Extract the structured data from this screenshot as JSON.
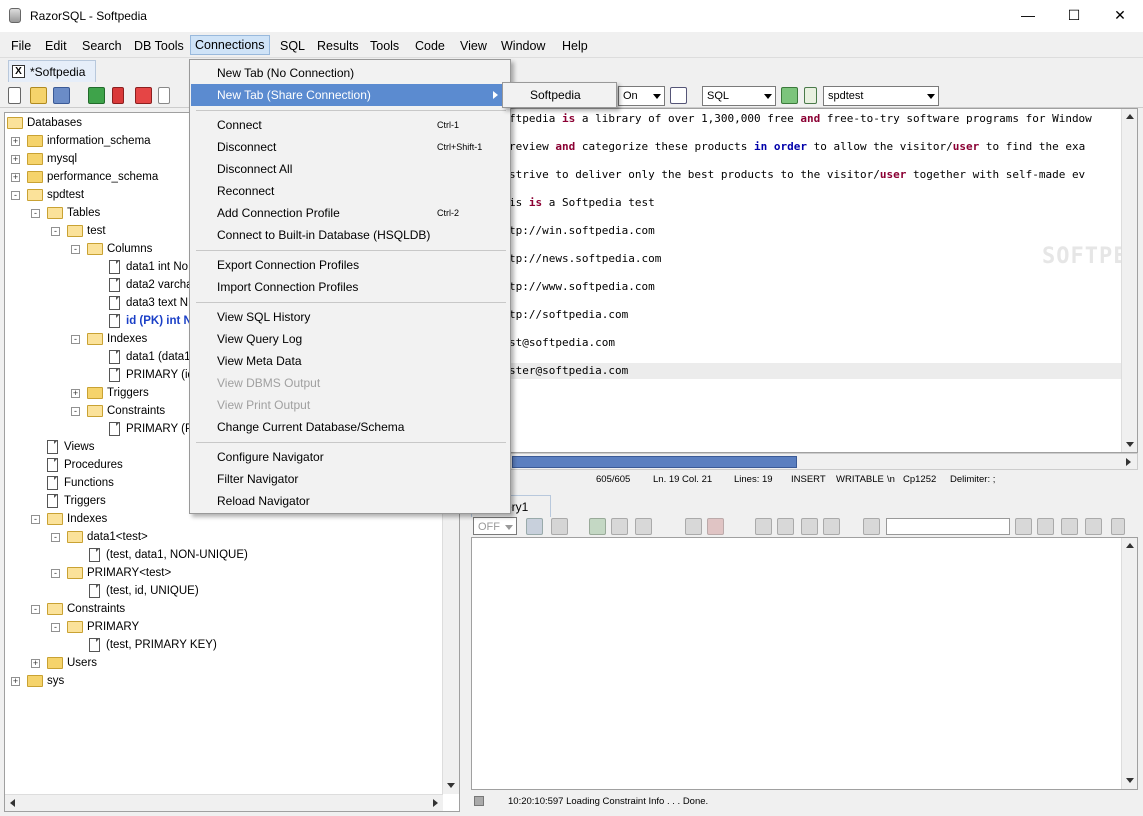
{
  "window": {
    "title": "RazorSQL - Softpedia",
    "minimize": "—",
    "maximize": "☐",
    "close": "✕"
  },
  "menubar": [
    "File",
    "Edit",
    "Search",
    "DB Tools",
    "Connections",
    "SQL",
    "Results",
    "Tools",
    "Code",
    "View",
    "Window",
    "Help"
  ],
  "tab": {
    "label": "*Softpedia",
    "close": "X"
  },
  "toolbar": {
    "on_combo": "On",
    "lang_combo": "SQL",
    "db_combo": "spdtest"
  },
  "tree": {
    "root": "Databases",
    "items": [
      "information_schema",
      "mysql",
      "performance_schema",
      "spdtest",
      "Tables",
      "test",
      "Columns",
      "data1 int No",
      "data2 varcha",
      "data3 text N",
      "id (PK) int N",
      "Indexes",
      "data1 (data1",
      "PRIMARY (id,",
      "Triggers",
      "Constraints",
      "PRIMARY (PR",
      "Views",
      "Procedures",
      "Functions",
      "Triggers",
      "Indexes",
      "data1<test>",
      "(test, data1, NON-UNIQUE)",
      "PRIMARY<test>",
      "(test, id, UNIQUE)",
      "Constraints",
      "PRIMARY",
      "(test, PRIMARY KEY)",
      "Users",
      "sys"
    ]
  },
  "editor": {
    "lines": [
      [
        "ftpedia ",
        "is",
        " a library of over 1,300,000 free ",
        "and",
        " free-to-try software programs for Window"
      ],
      [
        "review ",
        "and",
        " categorize these products ",
        "in",
        " ",
        "order",
        " to allow the visitor/",
        "user",
        " to find the exa"
      ],
      [
        "strive to deliver only the best products to the visitor/",
        "user",
        " together with self-made ev"
      ],
      [
        "is ",
        "is",
        " a Softpedia test"
      ],
      [
        "tp://win.softpedia.com"
      ],
      [
        "tp://news.softpedia.com"
      ],
      [
        "tp://www.softpedia.com"
      ],
      [
        "tp://softpedia.com"
      ],
      [
        "st@softpedia.com"
      ],
      [
        "ster@softpedia.com"
      ]
    ]
  },
  "status": {
    "pos": "605/605",
    "lncol": "Ln. 19 Col. 21",
    "lines": "Lines: 19",
    "mode": "INSERT",
    "writable": "WRITABLE",
    "nl": "\\n",
    "enc": "Cp1252",
    "delim": "Delimiter: ;"
  },
  "query_tab": {
    "label": "ery1"
  },
  "query_toolbar": {
    "off_combo": "OFF"
  },
  "bottom_status": "10:20:10:597 Loading Constraint Info . . . Done.",
  "watermark": "SOFTPEDIA",
  "menu": {
    "items": [
      {
        "label": "New Tab (No Connection)",
        "shortcut": ""
      },
      {
        "label": "New Tab (Share Connection)",
        "shortcut": "",
        "highlighted": true
      },
      {
        "label": "Connect",
        "shortcut": "Ctrl-1"
      },
      {
        "label": "Disconnect",
        "shortcut": "Ctrl+Shift-1"
      },
      {
        "label": "Disconnect All",
        "shortcut": ""
      },
      {
        "label": "Reconnect",
        "shortcut": ""
      },
      {
        "label": "Add Connection Profile",
        "shortcut": "Ctrl-2"
      },
      {
        "label": "Connect to Built-in Database (HSQLDB)",
        "shortcut": ""
      },
      {
        "label": "Export Connection Profiles",
        "shortcut": ""
      },
      {
        "label": "Import Connection Profiles",
        "shortcut": ""
      },
      {
        "label": "View SQL History",
        "shortcut": ""
      },
      {
        "label": "View Query Log",
        "shortcut": ""
      },
      {
        "label": "View Meta Data",
        "shortcut": ""
      },
      {
        "label": "View DBMS Output",
        "shortcut": "",
        "disabled": true
      },
      {
        "label": "View Print Output",
        "shortcut": "",
        "disabled": true
      },
      {
        "label": "Change Current Database/Schema",
        "shortcut": ""
      },
      {
        "label": "Configure Navigator",
        "shortcut": ""
      },
      {
        "label": "Filter Navigator",
        "shortcut": ""
      },
      {
        "label": "Reload Navigator",
        "shortcut": ""
      }
    ],
    "submenu": "Softpedia"
  },
  "colors": {
    "menu_highlight": "#5b8bd0",
    "keyword": "#8b0033",
    "keyword_blue": "#0000aa"
  }
}
